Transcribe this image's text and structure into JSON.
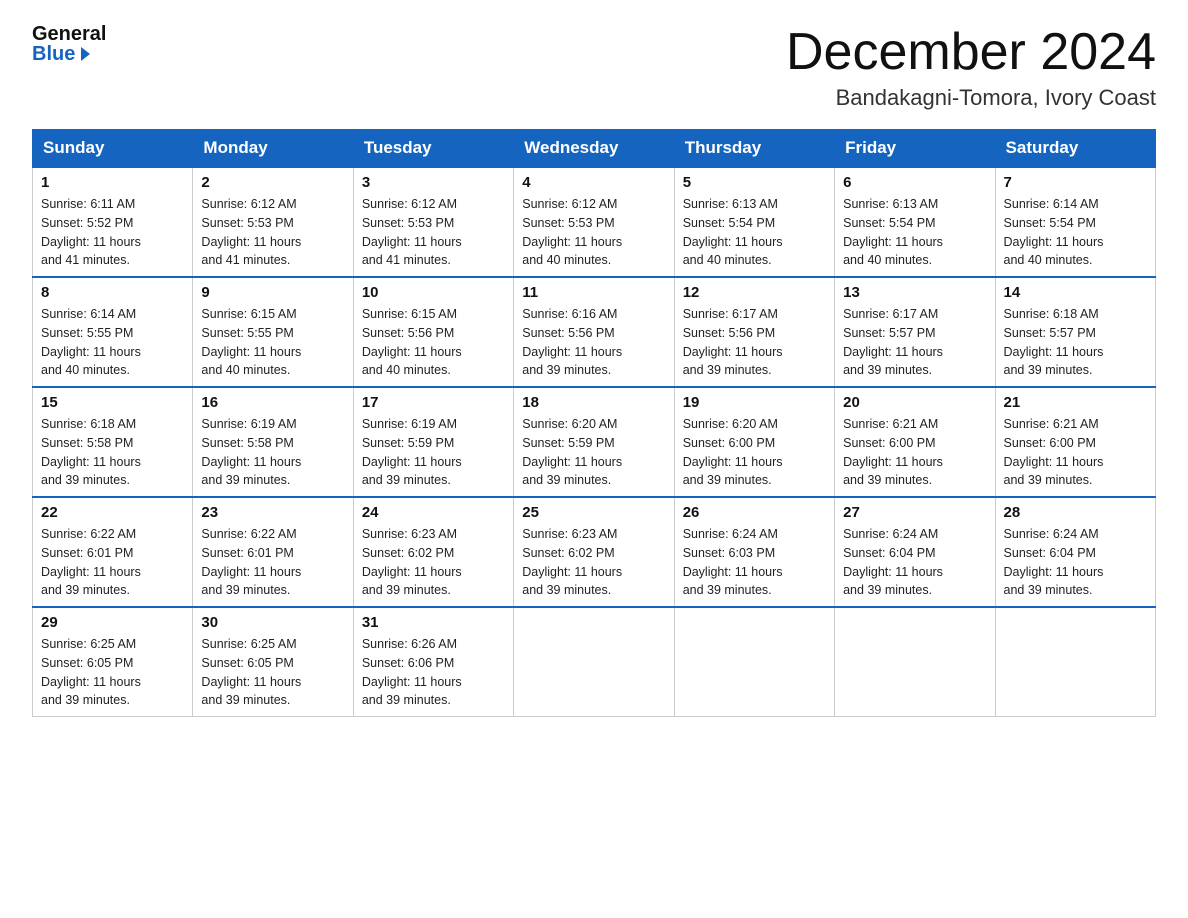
{
  "header": {
    "logo_general": "General",
    "logo_blue": "Blue",
    "title": "December 2024",
    "subtitle": "Bandakagni-Tomora, Ivory Coast"
  },
  "calendar": {
    "days_of_week": [
      "Sunday",
      "Monday",
      "Tuesday",
      "Wednesday",
      "Thursday",
      "Friday",
      "Saturday"
    ],
    "weeks": [
      [
        {
          "num": "1",
          "sunrise": "6:11 AM",
          "sunset": "5:52 PM",
          "daylight": "11 hours and 41 minutes."
        },
        {
          "num": "2",
          "sunrise": "6:12 AM",
          "sunset": "5:53 PM",
          "daylight": "11 hours and 41 minutes."
        },
        {
          "num": "3",
          "sunrise": "6:12 AM",
          "sunset": "5:53 PM",
          "daylight": "11 hours and 41 minutes."
        },
        {
          "num": "4",
          "sunrise": "6:12 AM",
          "sunset": "5:53 PM",
          "daylight": "11 hours and 40 minutes."
        },
        {
          "num": "5",
          "sunrise": "6:13 AM",
          "sunset": "5:54 PM",
          "daylight": "11 hours and 40 minutes."
        },
        {
          "num": "6",
          "sunrise": "6:13 AM",
          "sunset": "5:54 PM",
          "daylight": "11 hours and 40 minutes."
        },
        {
          "num": "7",
          "sunrise": "6:14 AM",
          "sunset": "5:54 PM",
          "daylight": "11 hours and 40 minutes."
        }
      ],
      [
        {
          "num": "8",
          "sunrise": "6:14 AM",
          "sunset": "5:55 PM",
          "daylight": "11 hours and 40 minutes."
        },
        {
          "num": "9",
          "sunrise": "6:15 AM",
          "sunset": "5:55 PM",
          "daylight": "11 hours and 40 minutes."
        },
        {
          "num": "10",
          "sunrise": "6:15 AM",
          "sunset": "5:56 PM",
          "daylight": "11 hours and 40 minutes."
        },
        {
          "num": "11",
          "sunrise": "6:16 AM",
          "sunset": "5:56 PM",
          "daylight": "11 hours and 39 minutes."
        },
        {
          "num": "12",
          "sunrise": "6:17 AM",
          "sunset": "5:56 PM",
          "daylight": "11 hours and 39 minutes."
        },
        {
          "num": "13",
          "sunrise": "6:17 AM",
          "sunset": "5:57 PM",
          "daylight": "11 hours and 39 minutes."
        },
        {
          "num": "14",
          "sunrise": "6:18 AM",
          "sunset": "5:57 PM",
          "daylight": "11 hours and 39 minutes."
        }
      ],
      [
        {
          "num": "15",
          "sunrise": "6:18 AM",
          "sunset": "5:58 PM",
          "daylight": "11 hours and 39 minutes."
        },
        {
          "num": "16",
          "sunrise": "6:19 AM",
          "sunset": "5:58 PM",
          "daylight": "11 hours and 39 minutes."
        },
        {
          "num": "17",
          "sunrise": "6:19 AM",
          "sunset": "5:59 PM",
          "daylight": "11 hours and 39 minutes."
        },
        {
          "num": "18",
          "sunrise": "6:20 AM",
          "sunset": "5:59 PM",
          "daylight": "11 hours and 39 minutes."
        },
        {
          "num": "19",
          "sunrise": "6:20 AM",
          "sunset": "6:00 PM",
          "daylight": "11 hours and 39 minutes."
        },
        {
          "num": "20",
          "sunrise": "6:21 AM",
          "sunset": "6:00 PM",
          "daylight": "11 hours and 39 minutes."
        },
        {
          "num": "21",
          "sunrise": "6:21 AM",
          "sunset": "6:00 PM",
          "daylight": "11 hours and 39 minutes."
        }
      ],
      [
        {
          "num": "22",
          "sunrise": "6:22 AM",
          "sunset": "6:01 PM",
          "daylight": "11 hours and 39 minutes."
        },
        {
          "num": "23",
          "sunrise": "6:22 AM",
          "sunset": "6:01 PM",
          "daylight": "11 hours and 39 minutes."
        },
        {
          "num": "24",
          "sunrise": "6:23 AM",
          "sunset": "6:02 PM",
          "daylight": "11 hours and 39 minutes."
        },
        {
          "num": "25",
          "sunrise": "6:23 AM",
          "sunset": "6:02 PM",
          "daylight": "11 hours and 39 minutes."
        },
        {
          "num": "26",
          "sunrise": "6:24 AM",
          "sunset": "6:03 PM",
          "daylight": "11 hours and 39 minutes."
        },
        {
          "num": "27",
          "sunrise": "6:24 AM",
          "sunset": "6:04 PM",
          "daylight": "11 hours and 39 minutes."
        },
        {
          "num": "28",
          "sunrise": "6:24 AM",
          "sunset": "6:04 PM",
          "daylight": "11 hours and 39 minutes."
        }
      ],
      [
        {
          "num": "29",
          "sunrise": "6:25 AM",
          "sunset": "6:05 PM",
          "daylight": "11 hours and 39 minutes."
        },
        {
          "num": "30",
          "sunrise": "6:25 AM",
          "sunset": "6:05 PM",
          "daylight": "11 hours and 39 minutes."
        },
        {
          "num": "31",
          "sunrise": "6:26 AM",
          "sunset": "6:06 PM",
          "daylight": "11 hours and 39 minutes."
        },
        null,
        null,
        null,
        null
      ]
    ],
    "labels": {
      "sunrise": "Sunrise:",
      "sunset": "Sunset:",
      "daylight": "Daylight:"
    }
  }
}
